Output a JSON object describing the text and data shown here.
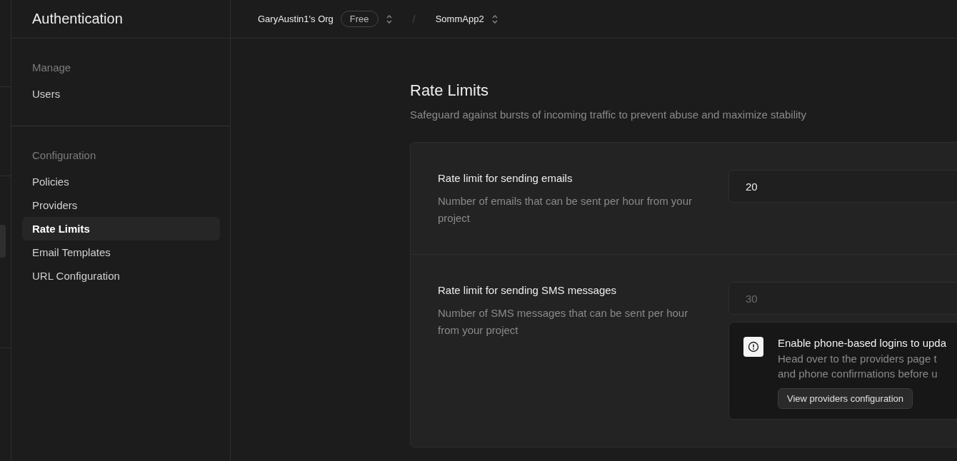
{
  "sidebar": {
    "title": "Authentication",
    "sections": [
      {
        "heading": "Manage",
        "items": [
          {
            "label": "Users",
            "selected": false
          }
        ]
      },
      {
        "heading": "Configuration",
        "items": [
          {
            "label": "Policies",
            "selected": false
          },
          {
            "label": "Providers",
            "selected": false
          },
          {
            "label": "Rate Limits",
            "selected": true
          },
          {
            "label": "Email Templates",
            "selected": false
          },
          {
            "label": "URL Configuration",
            "selected": false
          }
        ]
      }
    ]
  },
  "header": {
    "organization": "GaryAustin1's Org",
    "plan": "Free",
    "separator": "/",
    "project": "SommApp2"
  },
  "page": {
    "title": "Rate Limits",
    "subtitle": "Safeguard against bursts of incoming traffic to prevent abuse and maximize stability",
    "settings": [
      {
        "label": "Rate limit for sending emails",
        "description": "Number of emails that can be sent per hour from your project",
        "value": "20",
        "disabled": false
      },
      {
        "label": "Rate limit for sending SMS messages",
        "description": "Number of SMS messages that can be sent per hour from your project",
        "value": "30",
        "disabled": true,
        "notice": {
          "title": "Enable phone-based logins to upda",
          "lines": [
            "Head over to the providers page t",
            "and phone confirmations before u"
          ],
          "button": "View providers configuration"
        }
      }
    ]
  }
}
